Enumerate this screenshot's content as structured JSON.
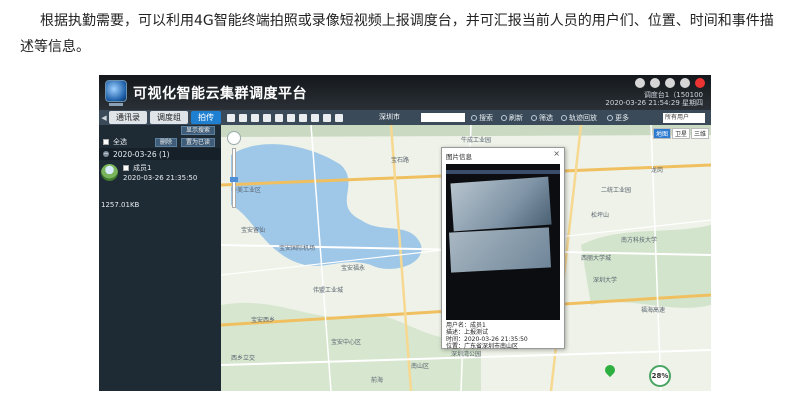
{
  "document": {
    "paragraph": "根据执勤需要，可以利用4G智能终端拍照或录像短视频上报调度台，并可汇报当前人员的用户们、位置、时间和事件描述等信息。"
  },
  "app": {
    "title": "可视化智能云集群调度平台",
    "header_info_line1": "调度台1（150100",
    "header_info_line2": "2020-03-26 21:54:29 星期四"
  },
  "toolbar": {
    "tabs": [
      {
        "label": "通讯录"
      },
      {
        "label": "调度组"
      },
      {
        "label": "拍传"
      }
    ],
    "city": "深圳市",
    "search_label": "搜索",
    "refresh_label": "刷新",
    "filter_label": "筛选",
    "track_label": "轨迹回放",
    "more_label": "更多",
    "user_select": "所有用户"
  },
  "side_panel": {
    "show_search_button": "显示搜索",
    "select_all_label": "全选",
    "delete_button": "删除",
    "mark_read_button": "置为已读",
    "group_label": "2020-03-26 (1)",
    "member_name": "成员1",
    "member_time": "2020-03-26 21:35:50",
    "file_size": "1257.01KB"
  },
  "map": {
    "type_buttons": [
      "地图",
      "卫星",
      "三维"
    ],
    "scale_badge": "28%",
    "labels": [
      "宝石路",
      "宝安国际机场",
      "华美工业区",
      "宝安福永",
      "伟盟工业城",
      "宝安西乡",
      "宝安中心区",
      "西乡立交",
      "南山区",
      "深圳大学",
      "南方科技大学",
      "西丽大学城",
      "牛成工业园",
      "前海",
      "二统工业园",
      "松坪山",
      "龙岗",
      "福海高速",
      "宝安留仙",
      "深圳湾公园"
    ]
  },
  "popup": {
    "title": "图片信息",
    "close": "×",
    "member_line": "用户名：成员1",
    "desc_line": "描述：上报测试",
    "time_line": "时间：2020-03-26 21:35:50",
    "location_line": "位置：广东省深圳市南山区"
  }
}
